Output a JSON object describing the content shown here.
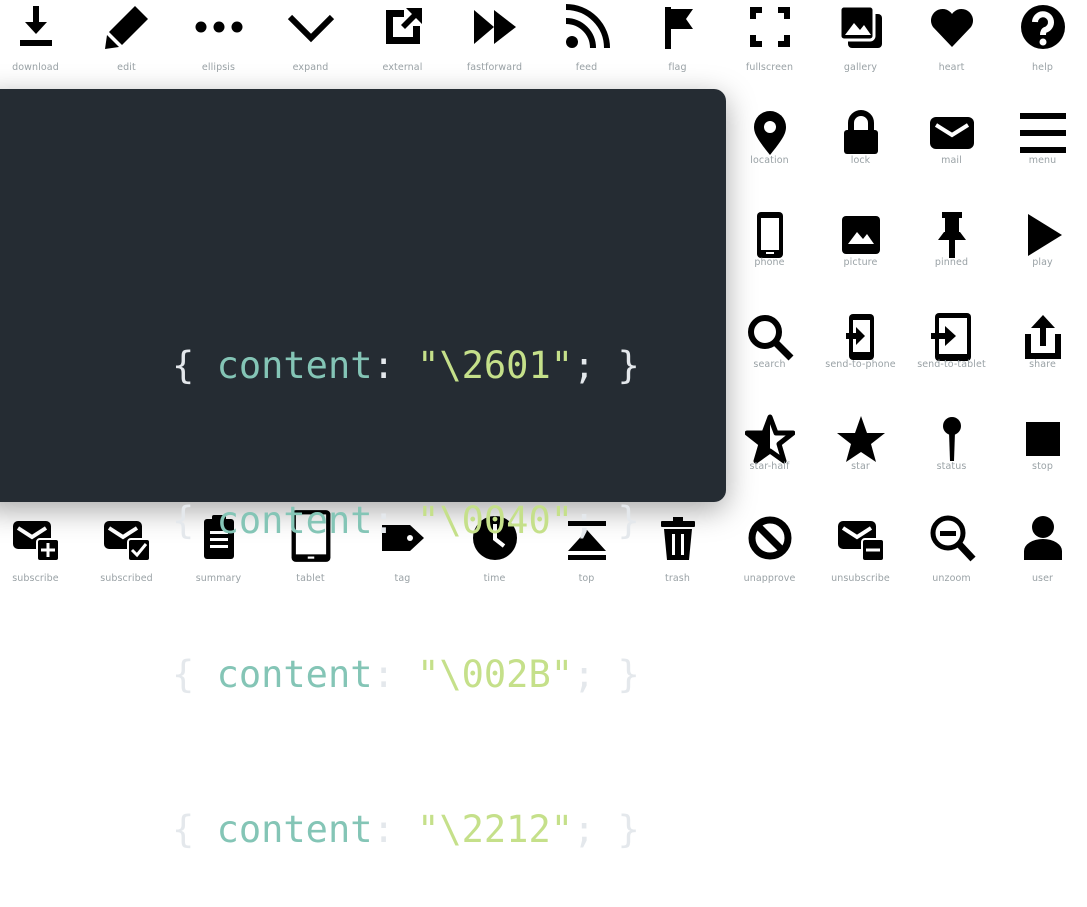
{
  "icons_top": [
    {
      "name": "download",
      "label": "download"
    },
    {
      "name": "edit",
      "label": "edit"
    },
    {
      "name": "ellipsis",
      "label": "ellipsis"
    },
    {
      "name": "expand",
      "label": "expand"
    },
    {
      "name": "external",
      "label": "external"
    },
    {
      "name": "fastforward",
      "label": "fastforward"
    },
    {
      "name": "feed",
      "label": "feed"
    },
    {
      "name": "flag",
      "label": "flag"
    },
    {
      "name": "fullscreen",
      "label": "fullscreen"
    },
    {
      "name": "gallery",
      "label": "gallery"
    },
    {
      "name": "heart",
      "label": "heart"
    },
    {
      "name": "help",
      "label": "help"
    }
  ],
  "icons_right": [
    {
      "name": "location",
      "label": "location"
    },
    {
      "name": "lock",
      "label": "lock"
    },
    {
      "name": "mail",
      "label": "mail"
    },
    {
      "name": "menu",
      "label": "menu"
    },
    {
      "name": "phone",
      "label": "phone"
    },
    {
      "name": "picture",
      "label": "picture"
    },
    {
      "name": "pinned",
      "label": "pinned"
    },
    {
      "name": "play",
      "label": "play"
    },
    {
      "name": "search",
      "label": "search"
    },
    {
      "name": "send-to-phone",
      "label": "send-to-phone"
    },
    {
      "name": "send-to-tablet",
      "label": "send-to-tablet"
    },
    {
      "name": "share",
      "label": "share"
    },
    {
      "name": "star-half",
      "label": "star-half"
    },
    {
      "name": "star",
      "label": "star"
    },
    {
      "name": "status",
      "label": "status"
    },
    {
      "name": "stop",
      "label": "stop"
    }
  ],
  "icons_bottom": [
    {
      "name": "subscribe",
      "label": "subscribe"
    },
    {
      "name": "subscribed",
      "label": "subscribed"
    },
    {
      "name": "summary",
      "label": "summary"
    },
    {
      "name": "tablet",
      "label": "tablet"
    },
    {
      "name": "tag",
      "label": "tag"
    },
    {
      "name": "time",
      "label": "time"
    },
    {
      "name": "top",
      "label": "top"
    },
    {
      "name": "trash",
      "label": "trash"
    },
    {
      "name": "unapprove",
      "label": "unapprove"
    },
    {
      "name": "unsubscribe",
      "label": "unsubscribe"
    },
    {
      "name": "unzoom",
      "label": "unzoom"
    },
    {
      "name": "user",
      "label": "user"
    }
  ],
  "code": {
    "lines": [
      {
        "open": "{",
        "property": "content",
        "colon": ":",
        "value": "\"\\2601\"",
        "close": "; }"
      },
      {
        "open": "{",
        "property": "content",
        "colon": ":",
        "value": "\"\\0040\"",
        "close": "; }"
      },
      {
        "open": "{",
        "property": "content",
        "colon": ":",
        "value": "\"\\002B\"",
        "close": "; }"
      },
      {
        "open": "{",
        "property": "content",
        "colon": ":",
        "value": "\"\\2212\"",
        "close": "; }"
      }
    ]
  },
  "colors": {
    "icon": "#000000",
    "label": "#9aa2a6",
    "panel": "#252c33",
    "property": "#84c5b6",
    "string": "#c5e08a",
    "punctuation": "#e4e8ec"
  }
}
